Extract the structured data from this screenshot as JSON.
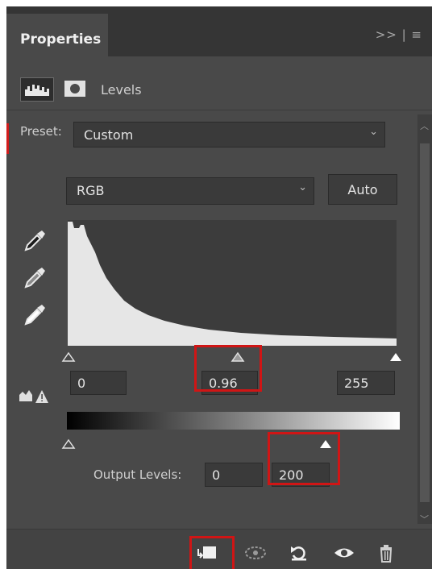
{
  "panel": {
    "tab_title": "Properties",
    "tab_menu": ">> | ≡",
    "adjustment_label": "Levels"
  },
  "preset": {
    "label": "Preset:",
    "value": "Custom"
  },
  "channel": {
    "value": "RGB",
    "auto_label": "Auto"
  },
  "input_levels": {
    "shadows": "0",
    "midtones": "0.96",
    "highlights": "255"
  },
  "output_levels": {
    "label": "Output Levels:",
    "low": "0",
    "high": "200"
  },
  "icons": {
    "adjustment": "levels-histogram-icon",
    "mask": "layer-mask-icon",
    "eyedroppers": [
      "black-point-eyedropper-icon",
      "gray-point-eyedropper-icon",
      "white-point-eyedropper-icon"
    ],
    "auto_clip_warning": "clipping-warning-icon",
    "footer": [
      "clip-to-layer-icon",
      "view-previous-state-icon",
      "reset-icon",
      "visibility-eye-icon",
      "delete-trash-icon"
    ]
  },
  "colors": {
    "panel_bg": "#494949",
    "highlight_red": "#d01515"
  }
}
